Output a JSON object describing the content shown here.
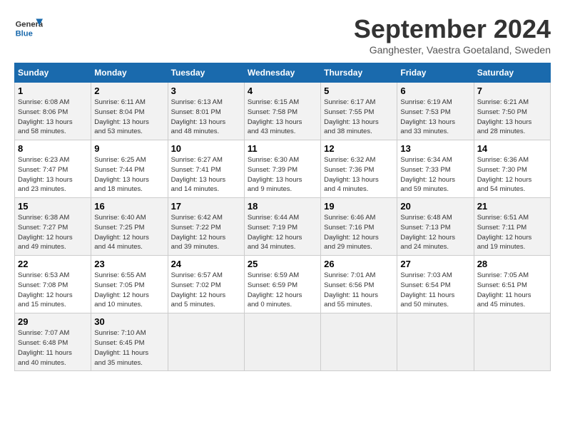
{
  "logo": {
    "line1": "General",
    "line2": "Blue"
  },
  "title": "September 2024",
  "subtitle": "Ganghester, Vaestra Goetaland, Sweden",
  "weekdays": [
    "Sunday",
    "Monday",
    "Tuesday",
    "Wednesday",
    "Thursday",
    "Friday",
    "Saturday"
  ],
  "weeks": [
    [
      {
        "num": "1",
        "rise": "6:08 AM",
        "set": "8:06 PM",
        "hours": "13 hours",
        "mins": "58 minutes."
      },
      {
        "num": "2",
        "rise": "6:11 AM",
        "set": "8:04 PM",
        "hours": "13 hours",
        "mins": "53 minutes."
      },
      {
        "num": "3",
        "rise": "6:13 AM",
        "set": "8:01 PM",
        "hours": "13 hours",
        "mins": "48 minutes."
      },
      {
        "num": "4",
        "rise": "6:15 AM",
        "set": "7:58 PM",
        "hours": "13 hours",
        "mins": "43 minutes."
      },
      {
        "num": "5",
        "rise": "6:17 AM",
        "set": "7:55 PM",
        "hours": "13 hours",
        "mins": "38 minutes."
      },
      {
        "num": "6",
        "rise": "6:19 AM",
        "set": "7:53 PM",
        "hours": "13 hours",
        "mins": "33 minutes."
      },
      {
        "num": "7",
        "rise": "6:21 AM",
        "set": "7:50 PM",
        "hours": "13 hours",
        "mins": "28 minutes."
      }
    ],
    [
      {
        "num": "8",
        "rise": "6:23 AM",
        "set": "7:47 PM",
        "hours": "13 hours",
        "mins": "23 minutes."
      },
      {
        "num": "9",
        "rise": "6:25 AM",
        "set": "7:44 PM",
        "hours": "13 hours",
        "mins": "18 minutes."
      },
      {
        "num": "10",
        "rise": "6:27 AM",
        "set": "7:41 PM",
        "hours": "13 hours",
        "mins": "14 minutes."
      },
      {
        "num": "11",
        "rise": "6:30 AM",
        "set": "7:39 PM",
        "hours": "13 hours",
        "mins": "9 minutes."
      },
      {
        "num": "12",
        "rise": "6:32 AM",
        "set": "7:36 PM",
        "hours": "13 hours",
        "mins": "4 minutes."
      },
      {
        "num": "13",
        "rise": "6:34 AM",
        "set": "7:33 PM",
        "hours": "12 hours",
        "mins": "59 minutes."
      },
      {
        "num": "14",
        "rise": "6:36 AM",
        "set": "7:30 PM",
        "hours": "12 hours",
        "mins": "54 minutes."
      }
    ],
    [
      {
        "num": "15",
        "rise": "6:38 AM",
        "set": "7:27 PM",
        "hours": "12 hours",
        "mins": "49 minutes."
      },
      {
        "num": "16",
        "rise": "6:40 AM",
        "set": "7:25 PM",
        "hours": "12 hours",
        "mins": "44 minutes."
      },
      {
        "num": "17",
        "rise": "6:42 AM",
        "set": "7:22 PM",
        "hours": "12 hours",
        "mins": "39 minutes."
      },
      {
        "num": "18",
        "rise": "6:44 AM",
        "set": "7:19 PM",
        "hours": "12 hours",
        "mins": "34 minutes."
      },
      {
        "num": "19",
        "rise": "6:46 AM",
        "set": "7:16 PM",
        "hours": "12 hours",
        "mins": "29 minutes."
      },
      {
        "num": "20",
        "rise": "6:48 AM",
        "set": "7:13 PM",
        "hours": "12 hours",
        "mins": "24 minutes."
      },
      {
        "num": "21",
        "rise": "6:51 AM",
        "set": "7:11 PM",
        "hours": "12 hours",
        "mins": "19 minutes."
      }
    ],
    [
      {
        "num": "22",
        "rise": "6:53 AM",
        "set": "7:08 PM",
        "hours": "12 hours",
        "mins": "15 minutes."
      },
      {
        "num": "23",
        "rise": "6:55 AM",
        "set": "7:05 PM",
        "hours": "12 hours",
        "mins": "10 minutes."
      },
      {
        "num": "24",
        "rise": "6:57 AM",
        "set": "7:02 PM",
        "hours": "12 hours",
        "mins": "5 minutes."
      },
      {
        "num": "25",
        "rise": "6:59 AM",
        "set": "6:59 PM",
        "hours": "12 hours",
        "mins": "0 minutes."
      },
      {
        "num": "26",
        "rise": "7:01 AM",
        "set": "6:56 PM",
        "hours": "11 hours",
        "mins": "55 minutes."
      },
      {
        "num": "27",
        "rise": "7:03 AM",
        "set": "6:54 PM",
        "hours": "11 hours",
        "mins": "50 minutes."
      },
      {
        "num": "28",
        "rise": "7:05 AM",
        "set": "6:51 PM",
        "hours": "11 hours",
        "mins": "45 minutes."
      }
    ],
    [
      {
        "num": "29",
        "rise": "7:07 AM",
        "set": "6:48 PM",
        "hours": "11 hours",
        "mins": "40 minutes."
      },
      {
        "num": "30",
        "rise": "7:10 AM",
        "set": "6:45 PM",
        "hours": "11 hours",
        "mins": "35 minutes."
      },
      null,
      null,
      null,
      null,
      null
    ]
  ]
}
